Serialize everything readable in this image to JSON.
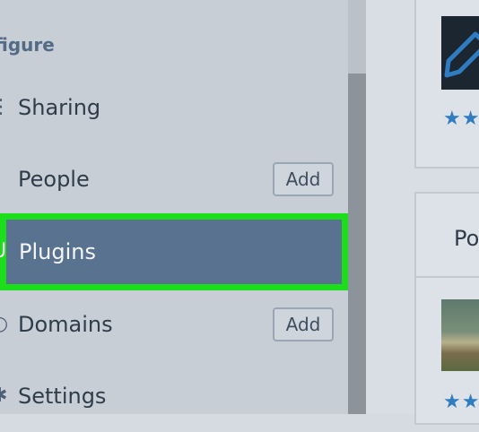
{
  "sidebar": {
    "section_title": "figure",
    "items": [
      {
        "label": "Sharing",
        "icon": "share-icon"
      },
      {
        "label": "People",
        "icon": "person-icon",
        "action": "Add"
      },
      {
        "label": "Plugins",
        "icon": "plugin-icon",
        "active": true
      },
      {
        "label": "Domains",
        "icon": "globe-icon",
        "action": "Add"
      },
      {
        "label": "Settings",
        "icon": "gear-icon"
      }
    ]
  },
  "content": {
    "card1": {
      "stars": "★★"
    },
    "card2": {
      "title": "Po",
      "stars": "★★"
    }
  },
  "colors": {
    "highlight": "#1dde1b",
    "active_bg": "#59728f",
    "section_title": "#536b85",
    "stars": "#2f7cc0"
  }
}
